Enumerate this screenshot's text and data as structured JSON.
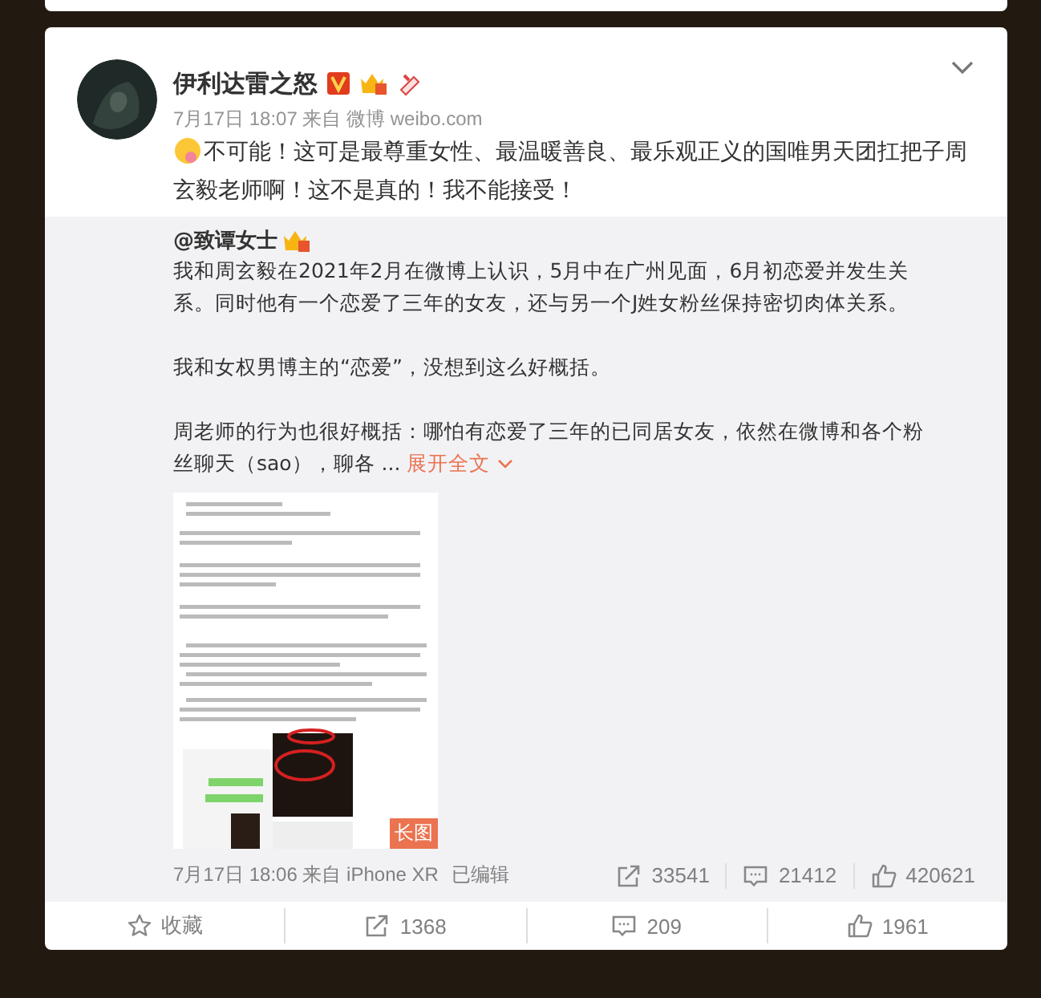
{
  "post": {
    "author": "伊利达雷之怒",
    "meta": "7月17日 18:07 来自 微博 weibo.com",
    "text": "不可能！这可是最尊重女性、最温暖善良、最乐观正义的国唯男天团扛把子周玄毅老师啊！这不是真的！我不能接受！",
    "repost": {
      "author": "@致谭女士",
      "paragraphs": [
        "我和周玄毅在2021年2月在微博上认识，5月中在广州见面，6月初恋爱并发生关系。同时他有一个恋爱了三年的女友，还与另一个J姓女粉丝保持密切肉体关系。",
        "我和女权男博主的“恋爱”，没想到这么好概括。",
        "周老师的行为也很好概括：哪怕有恋爱了三年的已同居女友，依然在微博和各个粉丝聊天（sao），聊各 ..."
      ],
      "expand_link": "展开全文",
      "image_badge": "长图",
      "meta": "7月17日 18:06 来自 iPhone XR",
      "edited": "已编辑",
      "stats": [
        {
          "kind": "repost",
          "count": "33541"
        },
        {
          "kind": "comment",
          "count": "21412"
        },
        {
          "kind": "like",
          "count": "420621"
        }
      ]
    },
    "actions": [
      {
        "kind": "favorite",
        "label": "收藏"
      },
      {
        "kind": "repost",
        "label": "1368"
      },
      {
        "kind": "comment",
        "label": "209"
      },
      {
        "kind": "like",
        "label": "1961"
      }
    ]
  }
}
